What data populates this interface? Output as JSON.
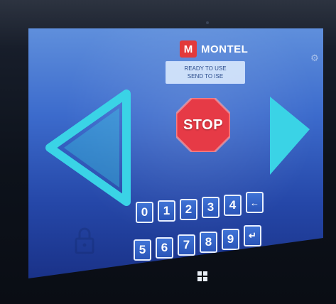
{
  "brand": {
    "logo_letter": "M",
    "name": "MONTEL"
  },
  "status": {
    "line1": "READY TO USE",
    "line2": "SEND TO ISE"
  },
  "controls": {
    "stop_label": "STOP",
    "left_arrow_icon": "left-triangle-arrow",
    "right_arrow_icon": "right-triangle-arrow",
    "settings_icon": "gear"
  },
  "keypad": {
    "row1": [
      "0",
      "1",
      "2",
      "3",
      "4",
      "←"
    ],
    "row2": [
      "5",
      "6",
      "7",
      "8",
      "9",
      "↵"
    ]
  },
  "colors": {
    "screen_top": "#5f8fdc",
    "screen_bottom": "#1a3288",
    "arrow_cyan": "#3ad3e6",
    "stop_red": "#e63a46",
    "brand_red": "#e23a3a"
  }
}
